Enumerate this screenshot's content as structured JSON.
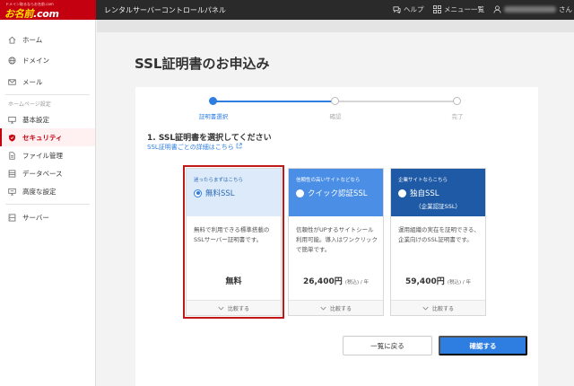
{
  "header": {
    "logo_tag": "ドメイン取るならお名前.com",
    "logo_text_main": "お名前",
    "logo_text_dom": ".com",
    "app_title": "レンタルサーバーコントロールパネル",
    "help_label": "ヘルプ",
    "menu_label": "メニュー一覧",
    "user_suffix": "さん"
  },
  "sidebar": {
    "items_top": [
      {
        "label": "ホーム",
        "icon": "home-icon"
      },
      {
        "label": "ドメイン",
        "icon": "globe-icon"
      },
      {
        "label": "メール",
        "icon": "mail-icon"
      }
    ],
    "section_label": "ホームページ設定",
    "items_site": [
      {
        "label": "基本設定",
        "icon": "monitor-icon"
      },
      {
        "label": "セキュリティ",
        "icon": "shield-icon",
        "active": true
      },
      {
        "label": "ファイル管理",
        "icon": "file-icon"
      },
      {
        "label": "データベース",
        "icon": "database-icon"
      },
      {
        "label": "高度な設定",
        "icon": "settings-monitor-icon"
      }
    ],
    "items_bottom": [
      {
        "label": "サーバー",
        "icon": "server-icon"
      }
    ]
  },
  "main": {
    "page_title": "SSL証明書のお申込み",
    "steps": [
      {
        "label": "証明書選択",
        "active": true
      },
      {
        "label": "確認",
        "active": false
      },
      {
        "label": "完了",
        "active": false
      }
    ],
    "section_title": "1. SSL証明書を選択してください",
    "detail_link": "SSL証明書ごとの詳細はこちら",
    "plans": [
      {
        "tag": "迷ったらまずはこちら",
        "name": "無料SSL",
        "subname": "",
        "selected": true,
        "description": "無料で利用できる標準搭載のSSLサーバー証明書です。",
        "price": "無料",
        "price_unit": "",
        "compare": "比較する"
      },
      {
        "tag": "信頼性の高いサイトなどなら",
        "name": "クイック認証SSL",
        "subname": "",
        "selected": false,
        "description": "信頼性がUPするサイトシール利用可能。導入はワンクリックで簡単です。",
        "price": "26,400円",
        "price_unit": "(税込) / 年",
        "compare": "比較する"
      },
      {
        "tag": "企業サイトならこちら",
        "name": "独自SSL",
        "subname": "（企業認証SSL）",
        "selected": false,
        "description": "運用組織の実在を証明できる、企業向けのSSL証明書です。",
        "price": "59,400円",
        "price_unit": "(税込) / 年",
        "compare": "比較する"
      }
    ],
    "back_button": "一覧に戻る",
    "confirm_button": "確認する"
  },
  "colors": {
    "brand_red": "#c40010",
    "accent_blue": "#2e7de1",
    "highlight_red": "#c01818"
  }
}
